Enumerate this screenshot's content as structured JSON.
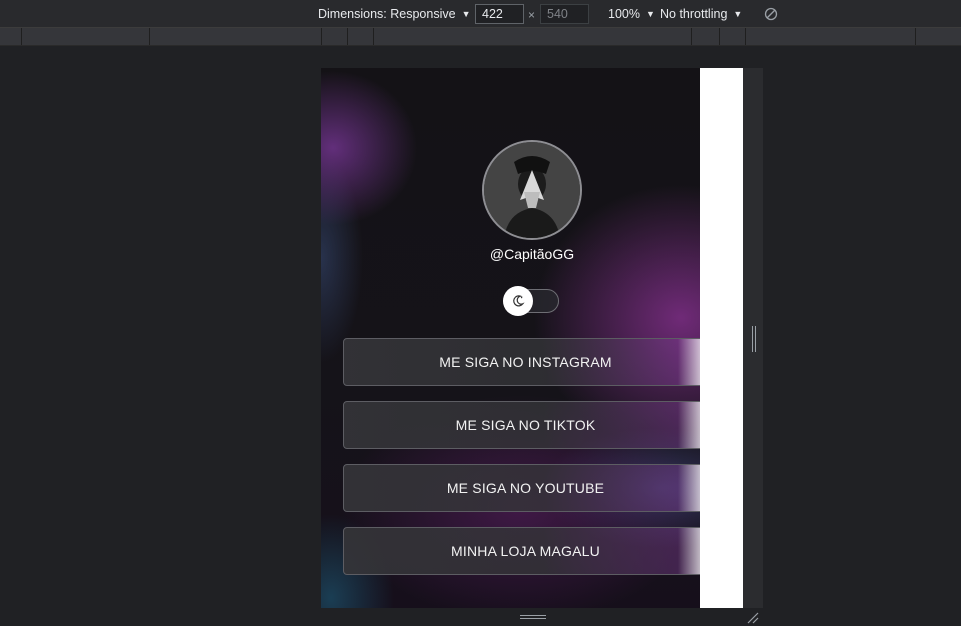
{
  "toolbar": {
    "dimensions_label": "Dimensions: Responsive",
    "width_value": "422",
    "height_value": "540",
    "times_symbol": "×",
    "zoom_label": "100%",
    "throttling_label": "No throttling",
    "rotate_icon": "rotate-disabled-icon"
  },
  "page": {
    "handle": "@CapitãoGG",
    "theme_toggle_icon": "moon-icon",
    "links": [
      {
        "label": "ME SIGA NO INSTAGRAM"
      },
      {
        "label": "ME SIGA NO TIKTOK"
      },
      {
        "label": "ME SIGA NO YOUTUBE"
      },
      {
        "label": "MINHA LOJA MAGALU"
      }
    ]
  },
  "colors": {
    "devtools_bg": "#202124",
    "toolbar_bg": "#292a2d",
    "accent_purple": "#96349f",
    "button_border": "#5d5d63"
  }
}
